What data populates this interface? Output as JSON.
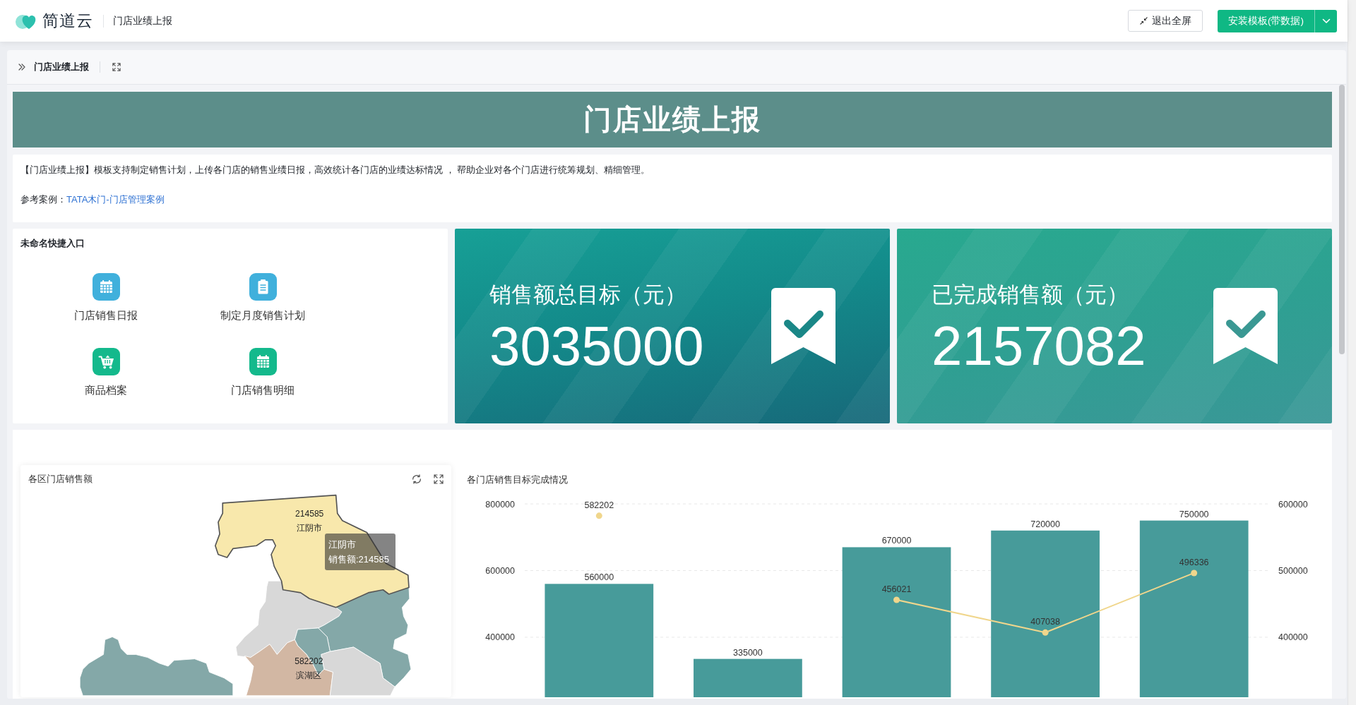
{
  "header": {
    "app_name": "简道云",
    "page_title": "门店业绩上报",
    "buttons": [
      {
        "kind": "outline",
        "label": "退出全屏"
      },
      {
        "kind": "split",
        "label": "安装模板(带数据)"
      }
    ]
  },
  "breadcrumb": {
    "title": "门店业绩上报"
  },
  "banner": {
    "title": "门店业绩上报"
  },
  "description": {
    "text": "【门店业绩上报】模板支持制定销售计划，上传各门店的销售业绩日报，高效统计各门店的业绩达标情况 ， 帮助企业对各个门店进行统筹规划、精细管理。",
    "reference_label": "参考案例：",
    "reference_link": "TATA木门-门店管理案例"
  },
  "shortcuts": {
    "title": "未命名快捷入口",
    "items": [
      {
        "label": "门店销售日报",
        "kind": "calendar",
        "color": "#40b0dc"
      },
      {
        "label": "制定月度销售计划",
        "kind": "clipboard",
        "color": "#40b0dc"
      },
      {
        "label": "商品档案",
        "kind": "cart",
        "color": "#14b98c"
      },
      {
        "label": "门店销售明细",
        "kind": "calendar",
        "color": "#14b98c"
      }
    ]
  },
  "stats": [
    {
      "label": "销售额总目标（元）",
      "value": "3035000"
    },
    {
      "label": "已完成销售额（元）",
      "value": "2157082"
    }
  ],
  "map": {
    "title": "各区门店销售额",
    "regions": [
      {
        "color": "#f8e8ac",
        "highlighted": true,
        "value": "214585",
        "name": "江阴市"
      },
      {
        "color": "#d8d8d8",
        "highlighted": false
      },
      {
        "color": "#84a8a8",
        "highlighted": false
      },
      {
        "color": "#84a8a8",
        "highlighted": false
      },
      {
        "color": "#84a8a8",
        "highlighted": false
      },
      {
        "color": "#d2b7a3",
        "highlighted": false,
        "value": "582202",
        "name": "滨湖区"
      },
      {
        "color": "#d8d8d8",
        "highlighted": false
      }
    ],
    "tooltip": {
      "title": "江阴市",
      "text": "销售额:214585"
    }
  },
  "chart": {
    "chart_data": {
      "type": "bar",
      "title": "各门店销售目标完成情况",
      "ylim": [
        220000,
        800000
      ],
      "yticks": [
        400000,
        600000,
        800000
      ],
      "y2lim": [
        310000,
        600000
      ],
      "y2ticks": [
        400000,
        500000,
        600000
      ],
      "data_labels": true,
      "series": [
        {
          "color": "#479b9a",
          "values": [
            560000,
            335000,
            670000,
            720000,
            750000
          ]
        },
        {
          "type": "line",
          "axis": "y2",
          "marker": true,
          "color": "#f0d68c",
          "values": [
            582202,
            null,
            456021,
            407038,
            496336
          ]
        }
      ]
    }
  }
}
